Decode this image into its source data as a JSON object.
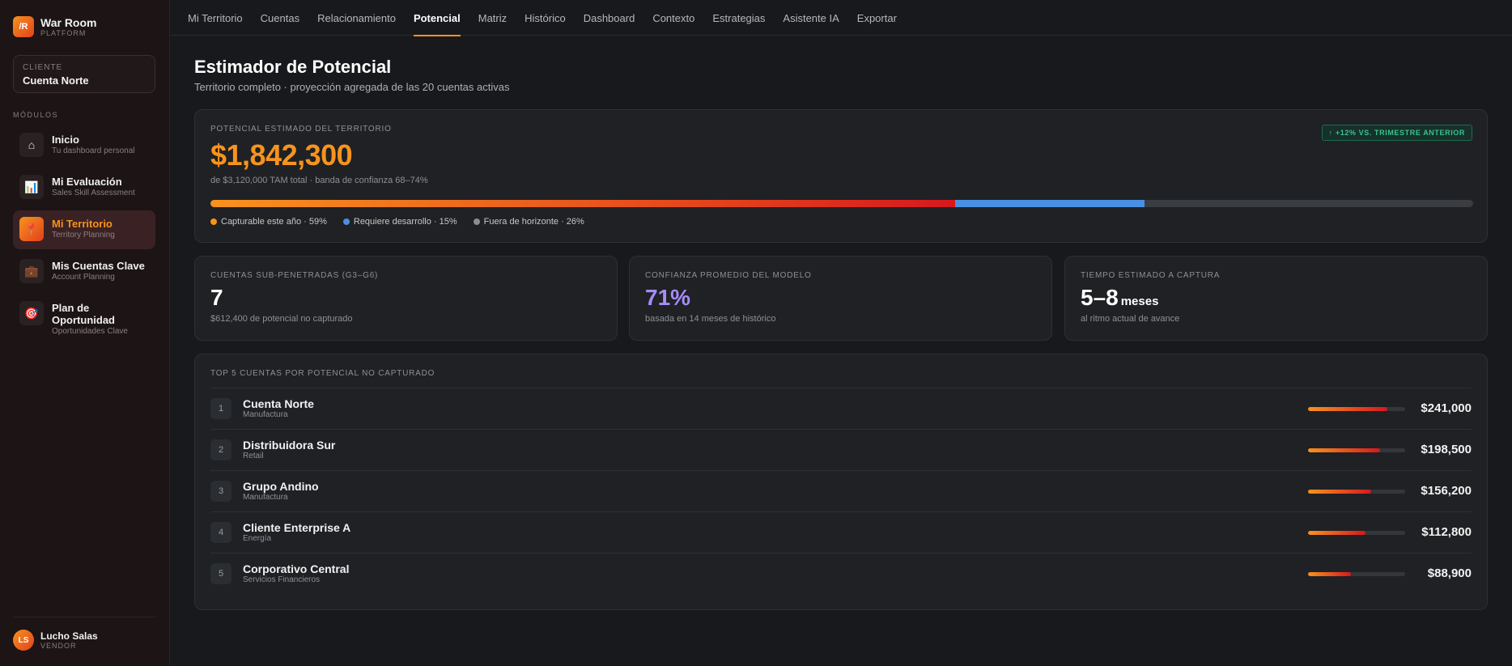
{
  "brand": {
    "logo": "/R",
    "name": "War Room",
    "sub": "PLATFORM"
  },
  "client": {
    "label": "CLIENTE",
    "name": "Cuenta Norte"
  },
  "sidebar": {
    "modules_label": "MÓDULOS",
    "items": [
      {
        "icon": "⌂",
        "icon_name": "home-icon",
        "title": "Inicio",
        "sub": "Tu dashboard personal"
      },
      {
        "icon": "📊",
        "icon_name": "chart-icon",
        "title": "Mi Evaluación",
        "sub": "Sales Skill Assessment"
      },
      {
        "icon": "📍",
        "icon_name": "pin-icon",
        "title": "Mi Territorio",
        "sub": "Territory Planning",
        "active": true
      },
      {
        "icon": "💼",
        "icon_name": "briefcase-icon",
        "title": "Mis Cuentas Clave",
        "sub": "Account Planning"
      },
      {
        "icon": "🎯",
        "icon_name": "target-icon",
        "title": "Plan de Oportunidad",
        "sub": "Oportunidades Clave"
      }
    ]
  },
  "user": {
    "initials": "LS",
    "name": "Lucho Salas",
    "role": "VENDOR"
  },
  "tabs": [
    {
      "label": "Mi Territorio"
    },
    {
      "label": "Cuentas"
    },
    {
      "label": "Relacionamiento"
    },
    {
      "label": "Potencial",
      "active": true
    },
    {
      "label": "Matriz"
    },
    {
      "label": "Histórico"
    },
    {
      "label": "Dashboard"
    },
    {
      "label": "Contexto"
    },
    {
      "label": "Estrategias"
    },
    {
      "label": "Asistente IA"
    },
    {
      "label": "Exportar"
    }
  ],
  "page": {
    "title": "Estimador de Potencial",
    "subtitle": "Territorio completo · proyección agregada de las 20 cuentas activas"
  },
  "hero": {
    "label": "POTENCIAL ESTIMADO DEL TERRITORIO",
    "value": "$1,842,300",
    "desc": "de $3,120,000 TAM total · banda de confianza 68–74%",
    "badge": "↑ +12% VS. TRIMESTRE ANTERIOR",
    "segments": [
      {
        "label": "Capturable este año · 59%",
        "pct": 59,
        "color": "#f7931e"
      },
      {
        "label": "Requiere desarrollo · 15%",
        "pct": 15,
        "color": "#4a90e2"
      },
      {
        "label": "Fuera de horizonte · 26%",
        "pct": 26,
        "color": "#8a8d92"
      }
    ]
  },
  "kpis": {
    "subpen": {
      "label": "CUENTAS SUB-PENETRADAS (G3–G6)",
      "value": "7",
      "desc": "$612,400 de potencial no capturado"
    },
    "conf": {
      "label": "CONFIANZA PROMEDIO DEL MODELO",
      "value": "71%",
      "desc": "basada en 14 meses de histórico"
    },
    "time": {
      "label": "TIEMPO ESTIMADO A CAPTURA",
      "value": "5–8",
      "unit": "meses",
      "desc": "al ritmo actual de avance"
    }
  },
  "top5": {
    "label": "TOP 5 CUENTAS POR POTENCIAL NO CAPTURADO",
    "rows": [
      {
        "rank": "1",
        "name": "Cuenta Norte",
        "industry": "Manufactura",
        "value": "$241,000",
        "fill": 0.82
      },
      {
        "rank": "2",
        "name": "Distribuidora Sur",
        "industry": "Retail",
        "value": "$198,500",
        "fill": 0.74
      },
      {
        "rank": "3",
        "name": "Grupo Andino",
        "industry": "Manufactura",
        "value": "$156,200",
        "fill": 0.65
      },
      {
        "rank": "4",
        "name": "Cliente Enterprise A",
        "industry": "Energía",
        "value": "$112,800",
        "fill": 0.59
      },
      {
        "rank": "5",
        "name": "Corporativo Central",
        "industry": "Servicios Financieros",
        "value": "$88,900",
        "fill": 0.44
      }
    ]
  }
}
